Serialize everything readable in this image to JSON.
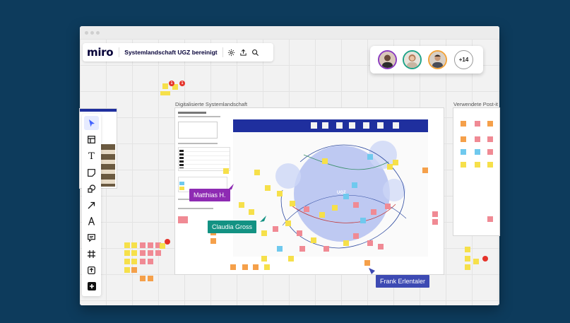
{
  "app": {
    "logo": "miro",
    "board_title": "Systemlandschaft UGZ bereinigt"
  },
  "toolbar_top": {
    "icons": [
      "settings-icon",
      "share-icon",
      "search-icon"
    ]
  },
  "collaborators": {
    "avatars": [
      {
        "name": "collaborator-avatar-1",
        "ring": "#8b3bbf"
      },
      {
        "name": "collaborator-avatar-2",
        "ring": "#1fa388"
      },
      {
        "name": "collaborator-avatar-3",
        "ring": "#f2a33a"
      }
    ],
    "more_count": "+14"
  },
  "left_tools": [
    {
      "name": "select-tool",
      "icon": "cursor-icon",
      "active": true
    },
    {
      "name": "template-tool",
      "icon": "template-icon"
    },
    {
      "name": "text-tool",
      "icon": "text-icon"
    },
    {
      "name": "sticky-note-tool",
      "icon": "sticky-note-icon"
    },
    {
      "name": "shapes-tool",
      "icon": "shapes-icon"
    },
    {
      "name": "line-tool",
      "icon": "arrow-icon"
    },
    {
      "name": "pen-tool",
      "icon": "pen-icon"
    },
    {
      "name": "comment-tool",
      "icon": "comment-icon"
    },
    {
      "name": "frame-tool",
      "icon": "frame-icon"
    },
    {
      "name": "upload-tool",
      "icon": "upload-icon"
    },
    {
      "name": "more-apps-tool",
      "icon": "plus-icon"
    }
  ],
  "frames": {
    "main_title": "Digitalisierte Systemlandschaft",
    "right_title": "Verwendete Post-it",
    "center_label": "UGZ"
  },
  "cursors": [
    {
      "name": "cursor-matthias",
      "label": "Matthias H.",
      "color": "#8e2bb3"
    },
    {
      "name": "cursor-claudia",
      "label": "Claudia Gross",
      "color": "#139283"
    },
    {
      "name": "cursor-frank",
      "label": "Frank Erlentaler",
      "color": "#3d4ab3"
    }
  ],
  "colors": {
    "background": "#0d3b5c",
    "sticky_yellow": "#f6e04a",
    "sticky_orange": "#f5a04a",
    "sticky_pink": "#f08a94",
    "sticky_blue": "#6fc9ee",
    "header_blue": "#1f2f9e",
    "bubble": "#a9b8ef"
  }
}
